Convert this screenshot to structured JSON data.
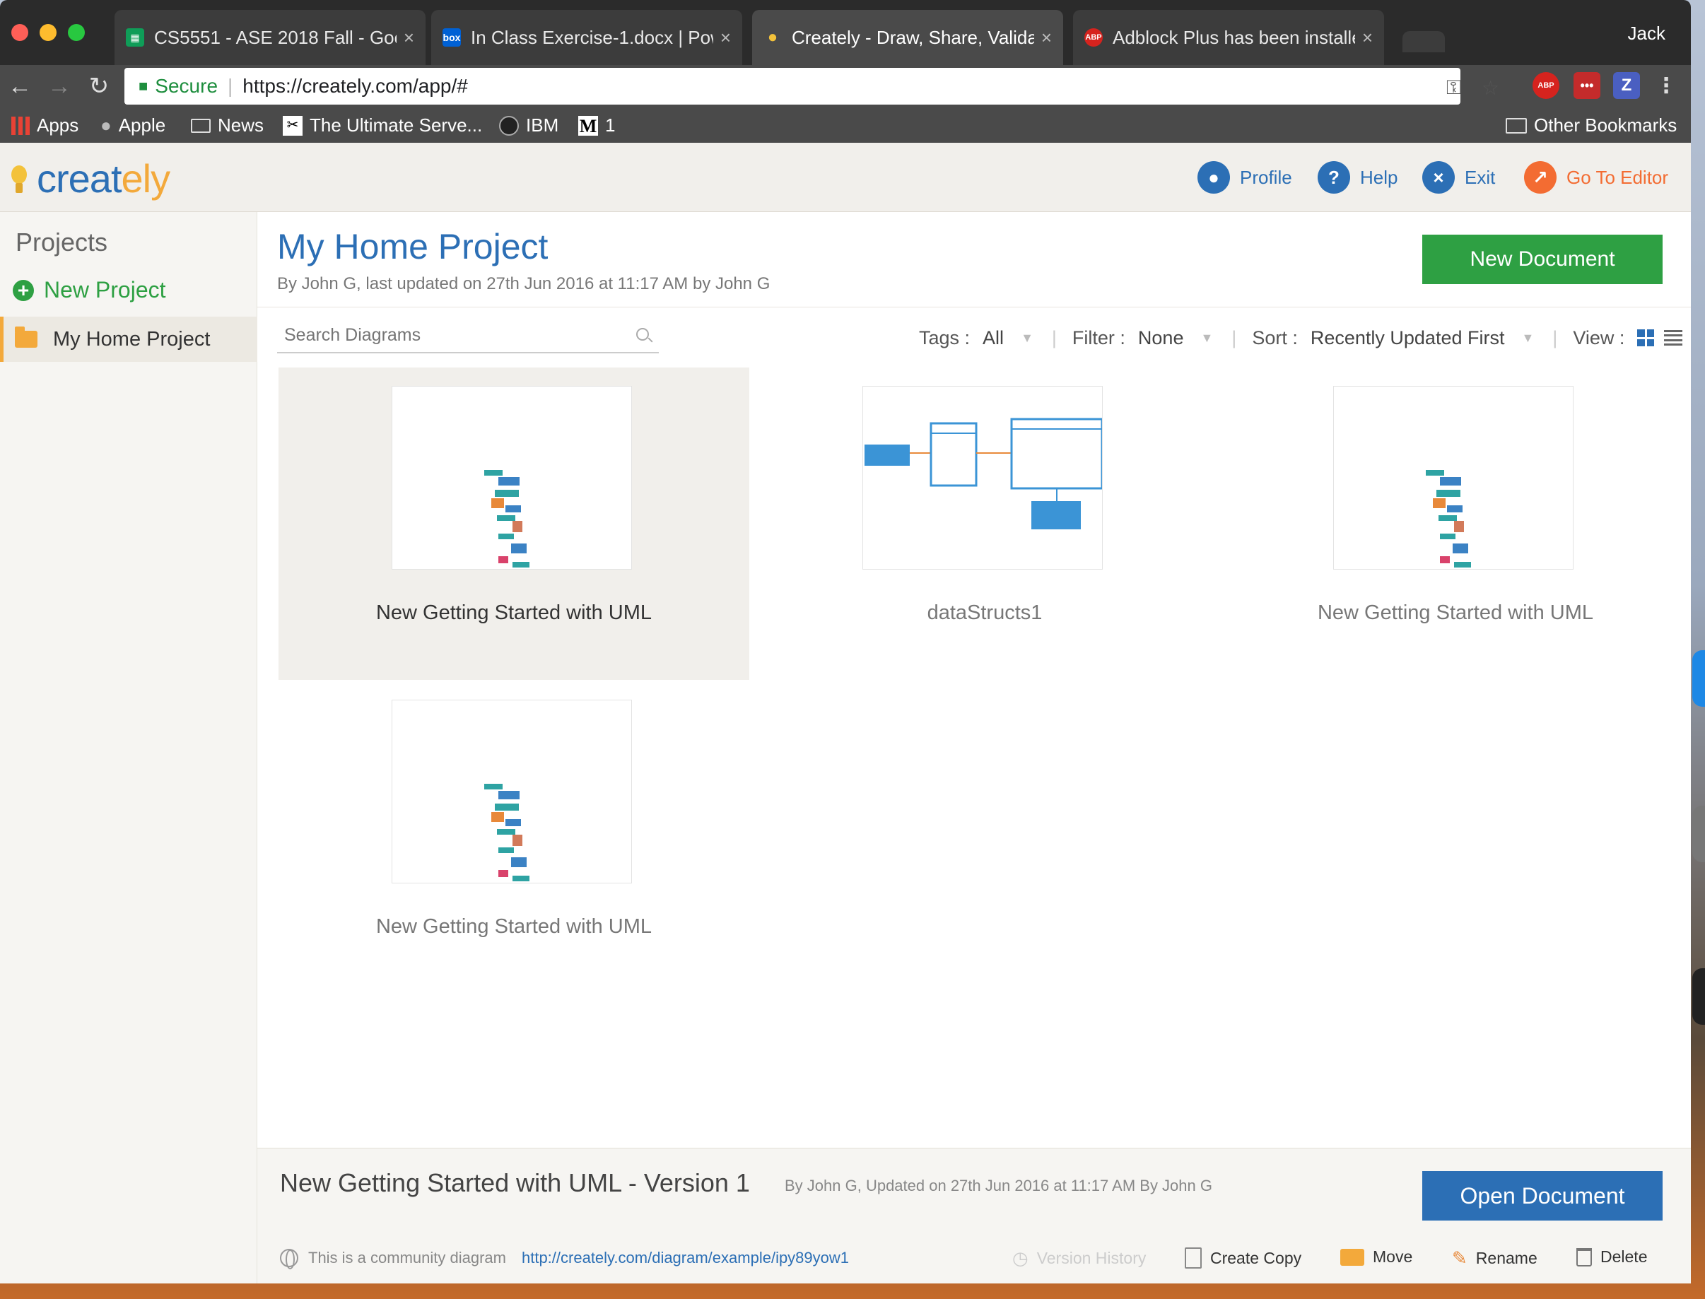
{
  "browser": {
    "tabs": [
      {
        "title": "CS5551 - ASE 2018 Fall - Goog",
        "icon": "sheets-icon",
        "active": false
      },
      {
        "title": "In Class Exercise-1.docx | Pow",
        "icon": "box-icon",
        "icon_text": "box",
        "active": false
      },
      {
        "title": "Creately - Draw, Share, Validat",
        "icon": "bulb-icon",
        "active": true
      },
      {
        "title": "Adblock Plus has been installe",
        "icon": "abp-icon",
        "icon_text": "ABP",
        "active": false
      }
    ],
    "user": "Jack",
    "secure_label": "Secure",
    "url": "https://creately.com/app/#",
    "bookmarks": [
      "Apps",
      "Apple",
      "News",
      "The Ultimate Serve...",
      "IBM",
      "1"
    ],
    "other_bookmarks": "Other Bookmarks",
    "ext_abp": "ABP",
    "ext_z": "Z"
  },
  "header": {
    "logo_main": "creat",
    "logo_accent": "ely",
    "profile": "Profile",
    "help": "Help",
    "exit": "Exit",
    "go_to_editor": "Go To Editor"
  },
  "sidebar": {
    "title": "Projects",
    "new_project": "New Project",
    "projects": [
      "My Home Project"
    ]
  },
  "main": {
    "project_title": "My Home Project",
    "project_meta": "By John G, last updated on 27th Jun 2016 at 11:17 AM by John G",
    "new_document": "New Document",
    "search_placeholder": "Search Diagrams",
    "tags_label": "Tags :",
    "tags_value": "All",
    "filter_label": "Filter :",
    "filter_value": "None",
    "sort_label": "Sort :",
    "sort_value": "Recently Updated First",
    "view_label": "View :",
    "documents": [
      {
        "name": "New Getting Started with UML",
        "selected": true
      },
      {
        "name": "dataStructs1",
        "selected": false
      },
      {
        "name": "New Getting Started with UML",
        "selected": false
      },
      {
        "name": "New Getting Started with UML",
        "selected": false
      }
    ]
  },
  "info": {
    "title": "New Getting Started with UML - Version 1",
    "meta": "By John G, Updated on 27th Jun 2016 at 11:17 AM By John G",
    "open_document": "Open Document",
    "community_text": "This is a community diagram",
    "community_link": "http://creately.com/diagram/example/ipy89yow1",
    "actions": {
      "version_history": "Version History",
      "create_copy": "Create Copy",
      "move": "Move",
      "rename": "Rename",
      "delete": "Delete"
    }
  },
  "colors": {
    "brand_blue": "#2c6fb5",
    "brand_orange": "#f3a93b",
    "new_doc_green": "#2ea043",
    "exit_blue": "#2c6fb5",
    "editor_orange": "#f36c32"
  }
}
